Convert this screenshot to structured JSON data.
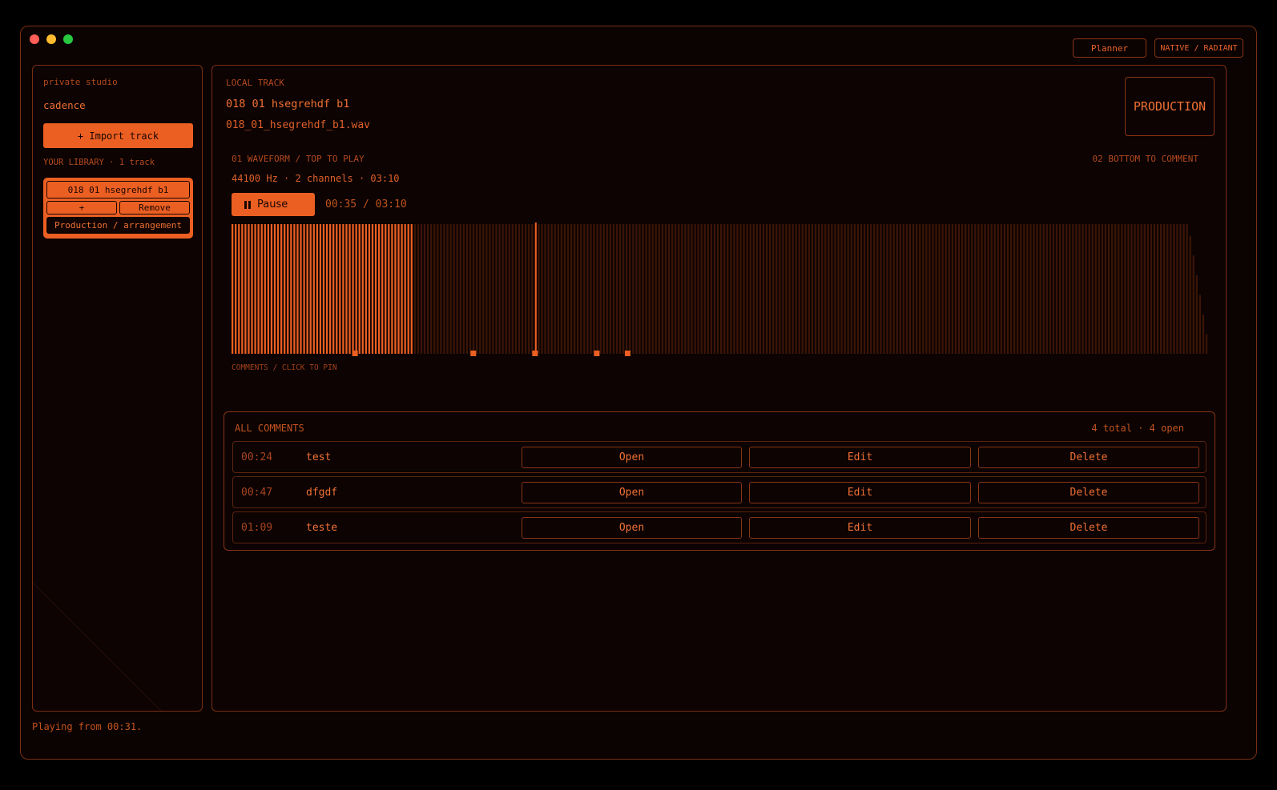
{
  "topbar": {
    "planner_label": "Planner",
    "theme_label": "NATIVE / RADIANT"
  },
  "sidebar": {
    "workspace": "private studio",
    "user": "cadence",
    "import_label": "+ Import track",
    "library_heading": "YOUR LIBRARY · 1 track",
    "track": {
      "name": "018 01 hsegrehdf b1",
      "add_label": "+",
      "remove_label": "Remove",
      "category": "Production / arrangement"
    }
  },
  "status": {
    "message": "Playing from 00:31."
  },
  "track": {
    "section_label": "LOCAL TRACK",
    "title": "018 01 hsegrehdf b1",
    "filename": "018_01_hsegrehdf_b1.wav",
    "stage_badge": "PRODUCTION"
  },
  "player": {
    "hint_top": "01 WAVEFORM / TOP TO PLAY",
    "hint_bottom": "02 BOTTOM TO COMMENT",
    "meta": "44100 Hz · 2 channels · 03:10",
    "pause_label": "Pause",
    "time_readout": "00:35 / 03:10",
    "position_seconds": 35,
    "duration_seconds": 190,
    "comment_markers_seconds": [
      24,
      47,
      59,
      71,
      77
    ],
    "caption": "COMMENTS / CLICK TO PIN",
    "accent": "#ec5f22",
    "dim": "#3b1507"
  },
  "comments": {
    "title": "ALL COMMENTS",
    "summary": "4 total · 4 open",
    "rows": [
      {
        "time": "00:24",
        "text": "test",
        "open": "Open",
        "edit": "Edit",
        "delete": "Delete"
      },
      {
        "time": "00:47",
        "text": "dfgdf",
        "open": "Open",
        "edit": "Edit",
        "delete": "Delete"
      },
      {
        "time": "01:09",
        "text": "teste",
        "open": "Open",
        "edit": "Edit",
        "delete": "Delete"
      }
    ]
  }
}
